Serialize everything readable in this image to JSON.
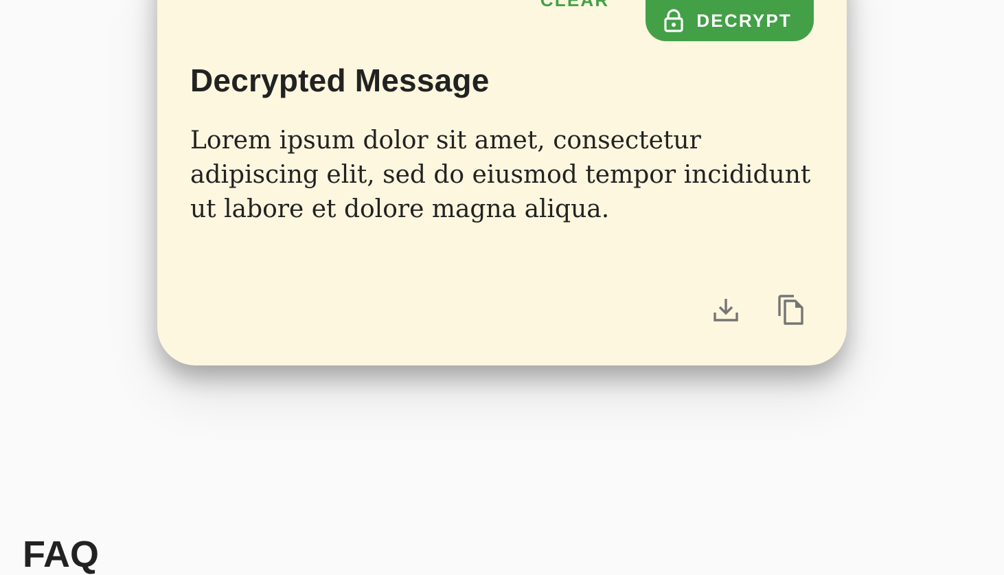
{
  "card": {
    "actions": {
      "clear_label": "CLEAR",
      "decrypt_label": "DECRYPT",
      "decrypt_icon": "lock-icon"
    },
    "title": "Decrypted Message",
    "message": "Lorem ipsum dolor sit amet, consectetur adipiscing elit, sed do eiusmod tempor incididunt ut labore et dolore magna aliqua.",
    "tools": {
      "download_icon": "download-icon",
      "copy_icon": "copy-icon"
    },
    "colors": {
      "background": "#fdf7df",
      "accent": "#43a047",
      "icon": "#757575"
    }
  },
  "faq": {
    "title": "FAQ"
  }
}
